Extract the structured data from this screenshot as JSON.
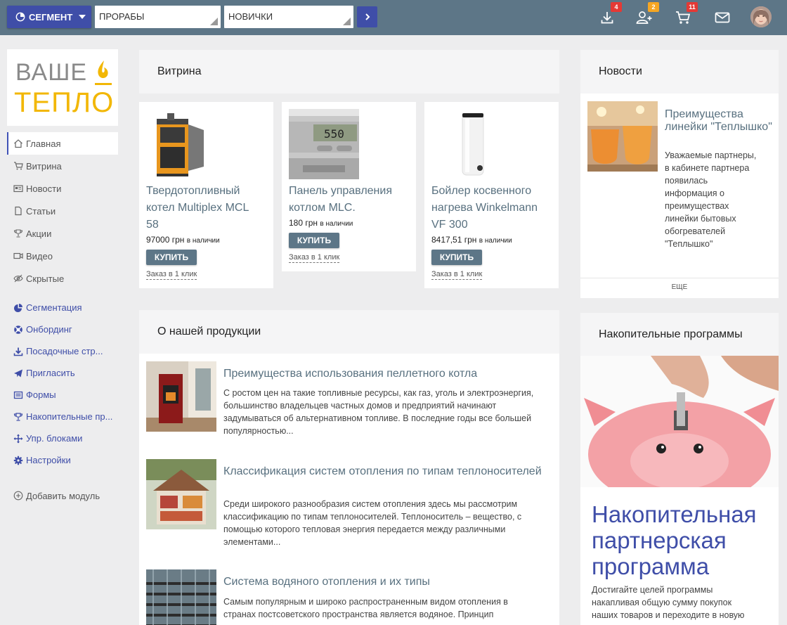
{
  "topbar": {
    "segment_label": "СЕГМЕНТ",
    "select1_value": "ПРОРАБЫ",
    "select2_value": "НОВИЧКИ",
    "badges": {
      "downloads": "4",
      "users": "2",
      "cart": "11"
    },
    "badge_colors": {
      "downloads": "#e53935",
      "users": "#f5a623",
      "cart": "#e53935"
    }
  },
  "logo": {
    "line1": "ВАШЕ",
    "line2": "ТЕПЛО"
  },
  "sidebar": {
    "items": [
      {
        "label": "Главная",
        "icon": "home-icon"
      },
      {
        "label": "Витрина",
        "icon": "cart-icon"
      },
      {
        "label": "Новости",
        "icon": "newspaper-icon"
      },
      {
        "label": "Статьи",
        "icon": "document-icon"
      },
      {
        "label": "Акции",
        "icon": "trophy-icon"
      },
      {
        "label": "Видео",
        "icon": "video-icon"
      },
      {
        "label": "Скрытые",
        "icon": "eye-slash-icon"
      }
    ],
    "admin_items": [
      {
        "label": "Сегментация",
        "icon": "pie-chart-icon"
      },
      {
        "label": "Онбординг",
        "icon": "lifebuoy-icon"
      },
      {
        "label": "Посадочные стр...",
        "icon": "download-icon"
      },
      {
        "label": "Пригласить",
        "icon": "paper-plane-icon"
      },
      {
        "label": "Формы",
        "icon": "form-icon"
      },
      {
        "label": "Накопительные пр...",
        "icon": "trophy-icon"
      },
      {
        "label": "Упр. блоками",
        "icon": "move-icon"
      },
      {
        "label": "Настройки",
        "icon": "gear-icon"
      }
    ],
    "add_module": "Добавить модуль"
  },
  "showcase": {
    "title": "Витрина",
    "products": [
      {
        "title_lines": [
          "Твердотопливный",
          "котел Multiplex MCL",
          "58"
        ],
        "price": "97000 грн",
        "stock": "в наличии",
        "buy": "КУПИТЬ",
        "oneclick": "Заказ в 1 клик"
      },
      {
        "title_lines": [
          "Панель управления",
          "котлом MLC."
        ],
        "price": "180 грн",
        "stock": "в наличии",
        "buy": "КУПИТЬ",
        "oneclick": "Заказ в 1 клик",
        "display_text": "550"
      },
      {
        "title_lines": [
          "Бойлер косвенного",
          "нагрева Winkelmann",
          "VF 300"
        ],
        "price": "8417,51 грн",
        "stock": "в наличии",
        "buy": "КУПИТЬ",
        "oneclick": "Заказ в 1 клик"
      }
    ]
  },
  "about": {
    "title": "О нашей продукции",
    "articles": [
      {
        "title": "Преимущества использования пеллетного котла",
        "text": "С ростом цен на такие топливные ресурсы, как газ, уголь и электроэнергия, большинство владельцев частных домов и предприятий начинают задумываться об альтернативном топливе. В последние годы все большей популярностью..."
      },
      {
        "title": "Классификация систем отопления по типам теплоносителей",
        "text": "Среди широкого разнообразия систем отопления здесь мы рассмотрим классификацию по типам теплоносителей. Теплоноситель – вещество, с помощью которого тепловая энергия передается между различными элементами..."
      },
      {
        "title": "Система водяного отопления и их типы",
        "text": "Самым популярным и широко распространенным видом отопления в странах постсоветского пространства является водяное. Принцип"
      }
    ]
  },
  "news": {
    "title": "Новости",
    "item_title": "Преимущества линейки \"Теплышко\"",
    "item_text": "Уважаемые партнеры, в кабинете партнера появилась информация о преимуществах линейки бытовых обогревателей \"Теплышко\"",
    "more": "ЕЩЕ"
  },
  "loyalty": {
    "title": "Накопительные программы",
    "headline": "Накопительная партнерская программа",
    "text": "Достигайте целей программы накапливая общую сумму покупок наших товаров и переходите в новую"
  },
  "colors": {
    "topbar": "#5d7687",
    "accent": "#3f4ea8",
    "link": "#58707f",
    "logo_gray": "#8a8a8a",
    "logo_yellow": "#f2b705"
  }
}
